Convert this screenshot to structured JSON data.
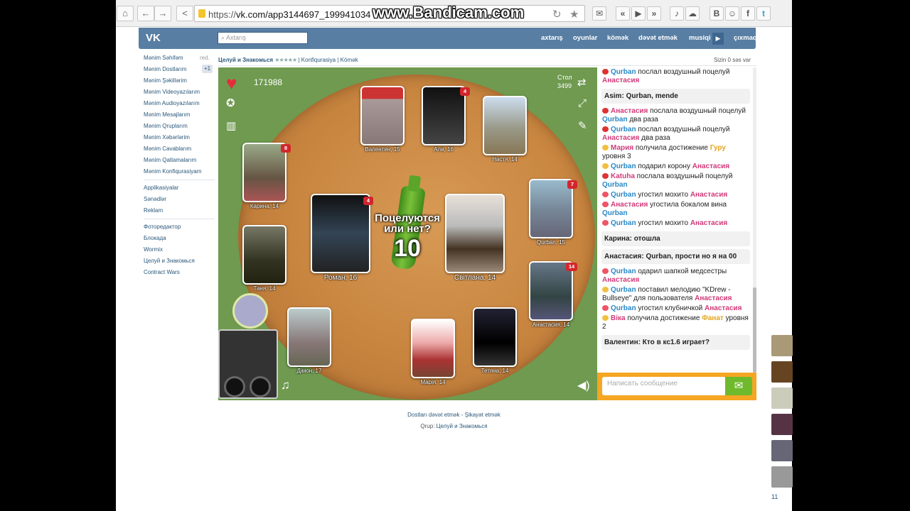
{
  "browser": {
    "url_prefix": "https://",
    "url_main": "vk.com/app3144697_199941034",
    "watermark": "www.Bandicam.com",
    "ext_icons": [
      "B",
      "☺",
      "f"
    ]
  },
  "header": {
    "logo": "VK",
    "search_placeholder": "Axtarış",
    "nav": [
      "axtarış",
      "oyunlar",
      "kömək",
      "dəvət etmək",
      "musiqi",
      "çıxmaq"
    ]
  },
  "sidebar": {
    "items": [
      "Mənim Səhifəm",
      "Mənim Dostlarım",
      "Mənim Şəkillərim",
      "Mənim Videoyazılarım",
      "Mənim Audioyazılarım",
      "Mənim Mesajlarım",
      "Mənim Qruplarım",
      "Mənim Xəbərlərim",
      "Mənim Cavablarım",
      "Mənim Qatlamalarım",
      "Mənim Konfiqurasiyam"
    ],
    "items2": [
      "Applikasiyalar",
      "Sənədlər",
      "Reklam"
    ],
    "apps": [
      "Фоторедактор",
      "Блокада",
      "Wormix",
      "Целуй и Знакомься",
      "Contract Wars"
    ],
    "red_label": "red.",
    "plus_label": "+1"
  },
  "app_header": {
    "title": "Целуй и Знакомься",
    "stars": "★★★★★",
    "config": "Konfiqurasiya",
    "help": "Kömək",
    "votes": "Sizin 0 səs var"
  },
  "game": {
    "hearts": "171988",
    "table_label": "Стол",
    "table_number": "3499",
    "question": "Поцелуются или нет?",
    "countdown": "10",
    "players": [
      {
        "name": "Валентин, 15",
        "badge": ""
      },
      {
        "name": "Али, 16",
        "badge": "4"
      },
      {
        "name": "Настя, 14",
        "badge": ""
      },
      {
        "name": "Карина, 14",
        "badge": "8"
      },
      {
        "name": "Роман, 16",
        "badge": "4"
      },
      {
        "name": "Світлана, 14",
        "badge": ""
      },
      {
        "name": "Qurban, 15",
        "badge": "7"
      },
      {
        "name": "Таня, 14",
        "badge": ""
      },
      {
        "name": "Анастасия, 14",
        "badge": "14"
      },
      {
        "name": "Дімон, 17",
        "badge": ""
      },
      {
        "name": "Марія, 14",
        "badge": ""
      },
      {
        "name": "Тетяна, 14",
        "badge": ""
      }
    ]
  },
  "chat": {
    "messages": [
      {
        "type": "event",
        "icon": "#d33",
        "parts": [
          [
            "n1",
            "Qurban"
          ],
          [
            "t",
            " послал воздушный поцелуй "
          ],
          [
            "n2",
            "Анастасия"
          ]
        ]
      },
      {
        "type": "bubble",
        "parts": [
          [
            "n1",
            "Asim:"
          ],
          [
            "t",
            " Qurban, mende"
          ]
        ]
      },
      {
        "type": "event",
        "icon": "#d33",
        "parts": [
          [
            "n2",
            "Анастасия"
          ],
          [
            "t",
            " послала воздушный поцелуй "
          ],
          [
            "n1",
            "Qurban"
          ],
          [
            "t",
            " два раза"
          ]
        ]
      },
      {
        "type": "event",
        "icon": "#d33",
        "parts": [
          [
            "n1",
            "Qurban"
          ],
          [
            "t",
            " послал воздушный поцелуй "
          ],
          [
            "n2",
            "Анастасия"
          ],
          [
            "t",
            " два раза"
          ]
        ]
      },
      {
        "type": "event",
        "icon": "#f0c040",
        "parts": [
          [
            "n2",
            "Мария"
          ],
          [
            "t",
            " получила достижение "
          ],
          [
            "n3",
            "Гуру"
          ],
          [
            "t",
            " уровня 3"
          ]
        ]
      },
      {
        "type": "event",
        "icon": "#f0c040",
        "parts": [
          [
            "n1",
            "Qurban"
          ],
          [
            "t",
            " подарил корону "
          ],
          [
            "n2",
            "Анастасия"
          ]
        ]
      },
      {
        "type": "event",
        "icon": "#d33",
        "parts": [
          [
            "n2",
            "Katuha"
          ],
          [
            "t",
            " послала воздушный поцелуй "
          ],
          [
            "n1",
            "Qurban"
          ]
        ]
      },
      {
        "type": "event",
        "icon": "#e56",
        "parts": [
          [
            "n1",
            "Qurban"
          ],
          [
            "t",
            " угостил мохито "
          ],
          [
            "n2",
            "Анастасия"
          ]
        ]
      },
      {
        "type": "event",
        "icon": "#e56",
        "parts": [
          [
            "n2",
            "Анастасия"
          ],
          [
            "t",
            " угостила бокалом вина "
          ],
          [
            "n1",
            "Qurban"
          ]
        ]
      },
      {
        "type": "event",
        "icon": "#e56",
        "parts": [
          [
            "n1",
            "Qurban"
          ],
          [
            "t",
            " угостил мохито "
          ],
          [
            "n2",
            "Анастасия"
          ]
        ]
      },
      {
        "type": "bubble",
        "parts": [
          [
            "n2",
            "Карина:"
          ],
          [
            "t",
            " отошла"
          ]
        ]
      },
      {
        "type": "bubble",
        "parts": [
          [
            "n2",
            "Анастасия:"
          ],
          [
            "t",
            " Qurban, прости но я на 00"
          ]
        ]
      },
      {
        "type": "event",
        "icon": "#e56",
        "parts": [
          [
            "n1",
            "Qurban"
          ],
          [
            "t",
            " одарил шапкой медсестры "
          ],
          [
            "n2",
            "Анастасия"
          ]
        ]
      },
      {
        "type": "event",
        "icon": "#f0c040",
        "parts": [
          [
            "n1",
            "Qurban"
          ],
          [
            "t",
            " поставил мелодию \"KDrew - Bullseye\" для пользователя "
          ],
          [
            "n2",
            "Анастасия"
          ]
        ]
      },
      {
        "type": "event",
        "icon": "#e56",
        "parts": [
          [
            "n1",
            "Qurban"
          ],
          [
            "t",
            " угостил клубничкой "
          ],
          [
            "n2",
            "Анастасия"
          ]
        ]
      },
      {
        "type": "event",
        "icon": "#f0c040",
        "parts": [
          [
            "n2",
            "Віка"
          ],
          [
            "t",
            " получила достижение "
          ],
          [
            "n3",
            "Фанат"
          ],
          [
            "t",
            " уровня 2"
          ]
        ]
      },
      {
        "type": "bubble",
        "parts": [
          [
            "n1",
            "Валентин:"
          ],
          [
            "t",
            " Кто в кс1.6 играет?"
          ]
        ]
      }
    ],
    "input_placeholder": "Написать сообщение"
  },
  "footer": {
    "invite": "Dostları dəvət etmək",
    "sep": " - ",
    "report": "Şikayət etmək",
    "group_label": "Qrup:",
    "group_name": "Целуй и Знакомься"
  },
  "right_panel": {
    "count": "11"
  }
}
